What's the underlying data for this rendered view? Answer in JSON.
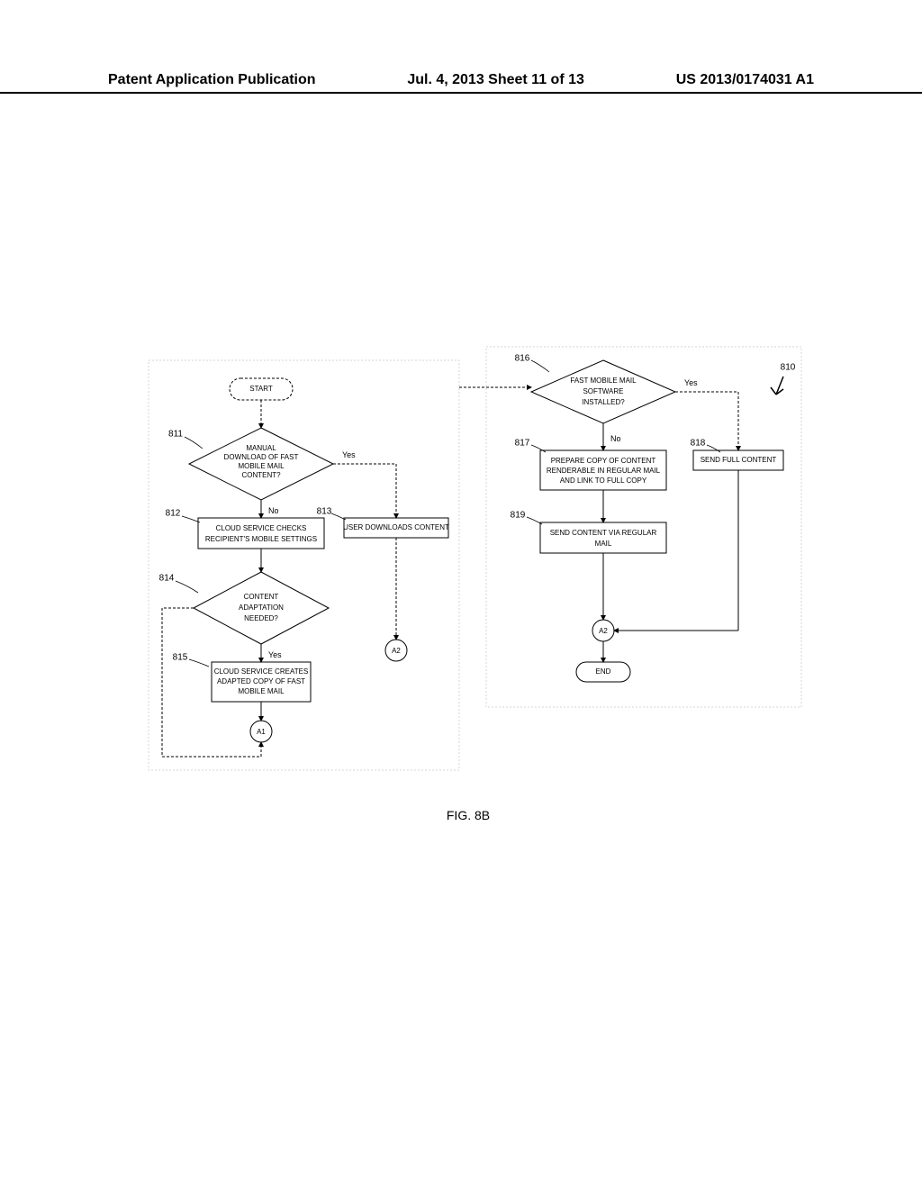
{
  "header": {
    "left": "Patent Application Publication",
    "center": "Jul. 4, 2013   Sheet 11 of 13",
    "right": "US 2013/0174031 A1"
  },
  "figure": {
    "caption": "FIG. 8B",
    "refs": {
      "r810": "810",
      "r811": "811",
      "r812": "812",
      "r813": "813",
      "r814": "814",
      "r815": "815",
      "r816": "816",
      "r817": "817",
      "r818": "818",
      "r819": "819"
    },
    "nodes": {
      "start": "START",
      "d811_l1": "MANUAL",
      "d811_l2": "DOWNLOAD OF FAST",
      "d811_l3": "MOBILE MAIL",
      "d811_l4": "CONTENT?",
      "b812_l1": "CLOUD SERVICE CHECKS",
      "b812_l2": "RECIPIENT'S MOBILE SETTINGS",
      "b813": "USER DOWNLOADS CONTENT",
      "d814_l1": "CONTENT",
      "d814_l2": "ADAPTATION",
      "d814_l3": "NEEDED?",
      "b815_l1": "CLOUD SERVICE CREATES",
      "b815_l2": "ADAPTED COPY OF FAST",
      "b815_l3": "MOBILE MAIL",
      "a1": "A1",
      "a2_left": "A2",
      "d816_l1": "FAST MOBILE MAIL",
      "d816_l2": "SOFTWARE",
      "d816_l3": "INSTALLED?",
      "b817_l1": "PREPARE COPY OF CONTENT",
      "b817_l2": "RENDERABLE IN REGULAR MAIL",
      "b817_l3": "AND LINK TO FULL COPY",
      "b818": "SEND FULL CONTENT",
      "b819_l1": "SEND CONTENT VIA REGULAR",
      "b819_l2": "MAIL",
      "a2_right": "A2",
      "end": "END"
    },
    "labels": {
      "yes": "Yes",
      "no": "No"
    }
  }
}
